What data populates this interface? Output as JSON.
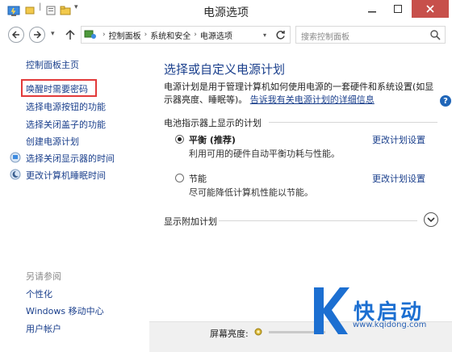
{
  "window": {
    "title": "电源选项"
  },
  "address": {
    "breadcrumbs": [
      "控制面板",
      "系统和安全",
      "电源选项"
    ],
    "search_placeholder": "搜索控制面板"
  },
  "sidebar": {
    "home": "控制面板主页",
    "items": [
      {
        "label": "唤醒时需要密码",
        "highlighted": true
      },
      {
        "label": "选择电源按钮的功能"
      },
      {
        "label": "选择关闭盖子的功能"
      },
      {
        "label": "创建电源计划"
      },
      {
        "label": "选择关闭显示器的时间",
        "icon": "monitor-icon"
      },
      {
        "label": "更改计算机睡眠时间",
        "icon": "moon-icon"
      }
    ],
    "see_also_label": "另请参阅",
    "see_also": [
      "个性化",
      "Windows 移动中心",
      "用户帐户"
    ]
  },
  "main": {
    "heading": "选择或自定义电源计划",
    "description": "电源计划是用于管理计算机如何使用电源的一套硬件和系统设置(如显示器亮度、睡眠等)。",
    "description_link": "告诉我有关电源计划的详细信息",
    "section_label": "电池指示器上显示的计划",
    "plans": [
      {
        "name": "平衡 (推荐)",
        "desc": "利用可用的硬件自动平衡功耗与性能。",
        "selected": true,
        "link": "更改计划设置"
      },
      {
        "name": "节能",
        "desc": "尽可能降低计算机性能以节能。",
        "selected": false,
        "link": "更改计划设置"
      }
    ],
    "additional_plans": "显示附加计划"
  },
  "bottom": {
    "brightness_label": "屏幕亮度:"
  },
  "watermark": {
    "brand": "快启动",
    "url": "www.kqidong.com"
  },
  "colors": {
    "link": "#1a3f8c",
    "close_button": "#c7504b",
    "highlight_box": "#e23a3a",
    "watermark": "#1c6fd1"
  }
}
